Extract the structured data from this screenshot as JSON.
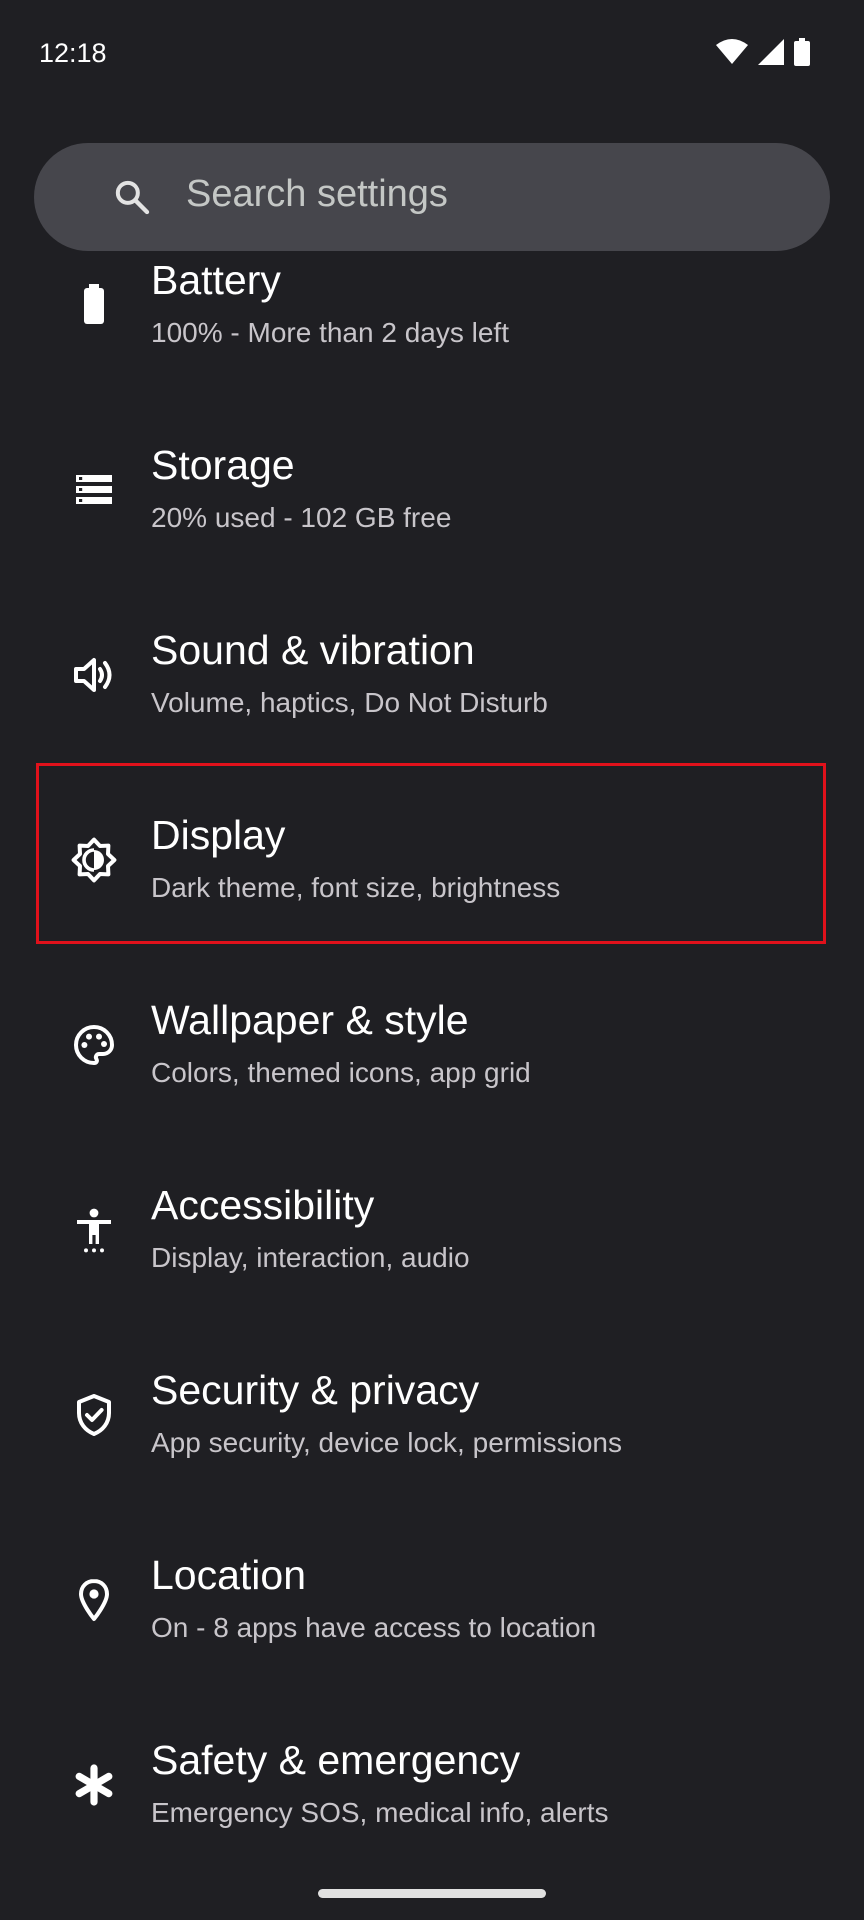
{
  "status_bar": {
    "time": "12:18",
    "icons": [
      "wifi-icon",
      "cell-signal-icon",
      "battery-icon"
    ]
  },
  "search": {
    "placeholder": "Search settings"
  },
  "settings": [
    {
      "id": "battery",
      "title": "Battery",
      "subtitle": "100% - More than 2 days left",
      "icon": "battery-icon"
    },
    {
      "id": "storage",
      "title": "Storage",
      "subtitle": "20% used - 102 GB free",
      "icon": "storage-icon"
    },
    {
      "id": "sound",
      "title": "Sound & vibration",
      "subtitle": "Volume, haptics, Do Not Disturb",
      "icon": "volume-icon"
    },
    {
      "id": "display",
      "title": "Display",
      "subtitle": "Dark theme, font size, brightness",
      "icon": "brightness-icon",
      "highlighted": true
    },
    {
      "id": "wallpaper",
      "title": "Wallpaper & style",
      "subtitle": "Colors, themed icons, app grid",
      "icon": "palette-icon"
    },
    {
      "id": "accessibility",
      "title": "Accessibility",
      "subtitle": "Display, interaction, audio",
      "icon": "accessibility-icon"
    },
    {
      "id": "security",
      "title": "Security & privacy",
      "subtitle": "App security, device lock, permissions",
      "icon": "shield-check-icon"
    },
    {
      "id": "location",
      "title": "Location",
      "subtitle": "On - 8 apps have access to location",
      "icon": "location-pin-icon"
    },
    {
      "id": "safety",
      "title": "Safety & emergency",
      "subtitle": "Emergency SOS, medical info, alerts",
      "icon": "asterisk-icon"
    }
  ],
  "colors": {
    "background": "#1f1f23",
    "search_bar": "#46464c",
    "highlight": "#e0111b",
    "title_text": "#ffffff",
    "subtitle_text": "#c8c5ca"
  }
}
